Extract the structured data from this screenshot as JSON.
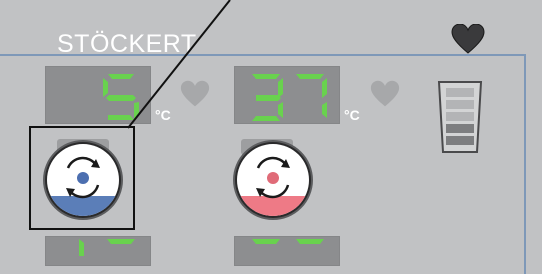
{
  "brand": {
    "name": "STÖCKERT"
  },
  "channels": [
    {
      "temperature": "5",
      "unit": "°C",
      "indicator_color": "#4c6fb0",
      "band_color": "#5b7eb8"
    },
    {
      "temperature": "37",
      "unit": "°C",
      "indicator_color": "#e06b78",
      "band_color": "#ee7a86"
    }
  ],
  "level_indicator": {
    "segments_total": 5,
    "segments_filled": 3
  },
  "colors": {
    "background": "#c1c2c4",
    "display": "#8d8e90",
    "segment_on": "#69d24e",
    "frame_line": "#7e98b8",
    "highlight_box": "#111111"
  },
  "icons": {
    "status": "heart-icon",
    "mode": "rotate-arrows-icon"
  }
}
